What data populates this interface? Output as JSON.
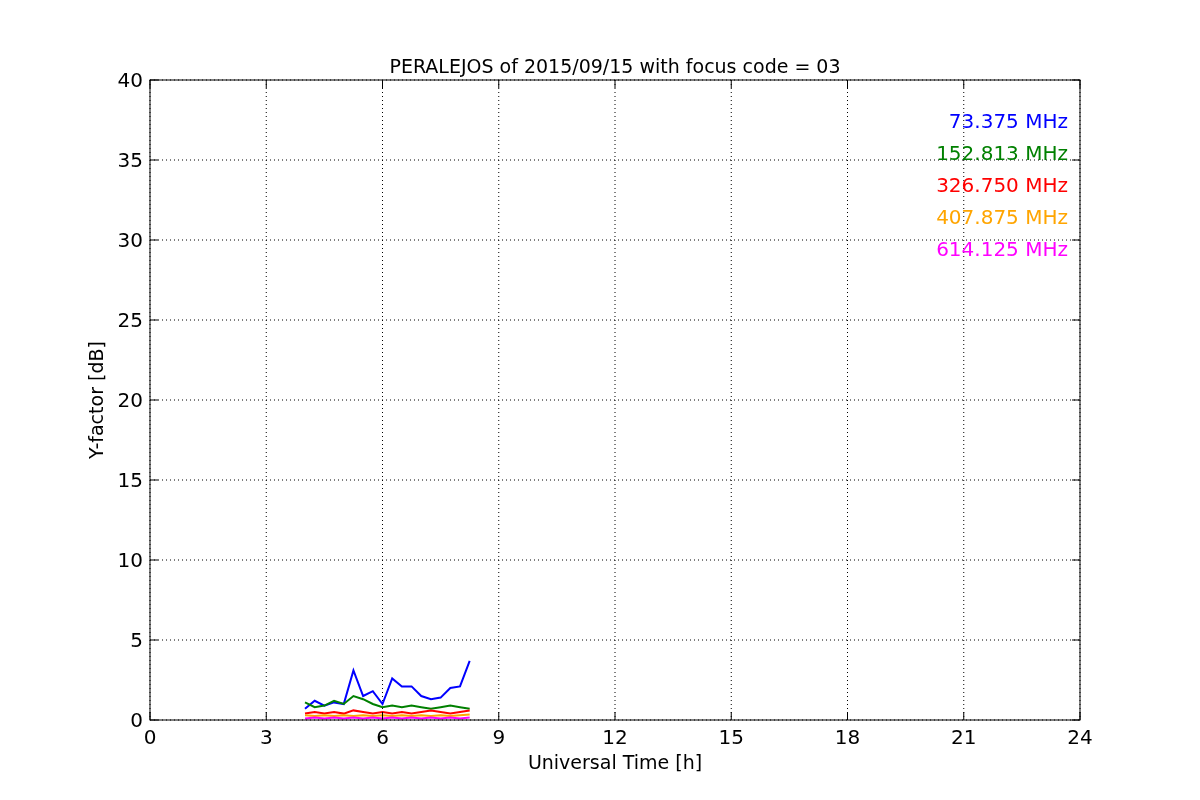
{
  "chart_data": {
    "type": "line",
    "title": "PERALEJOS of 2015/09/15 with focus code = 03",
    "xlabel": "Universal Time [h]",
    "ylabel": "Y-factor [dB]",
    "x": [
      4,
      4.25,
      4.5,
      4.75,
      5,
      5.25,
      5.5,
      5.75,
      6,
      6.25,
      6.5,
      6.75,
      7,
      7.25,
      7.5,
      7.75,
      8,
      8.25
    ],
    "grid": true,
    "xlim": [
      0,
      24
    ],
    "ylim": [
      0,
      40
    ],
    "xticks": [
      0,
      3,
      6,
      9,
      12,
      15,
      18,
      21,
      24
    ],
    "yticks": [
      0,
      5,
      10,
      15,
      20,
      25,
      30,
      35,
      40
    ],
    "series": [
      {
        "name": "73.375 MHz",
        "color": "#0000ff",
        "values": [
          0.7,
          1.2,
          0.9,
          1.1,
          1.0,
          3.1,
          1.5,
          1.8,
          1.0,
          2.6,
          2.1,
          2.1,
          1.5,
          1.3,
          1.4,
          2.0,
          2.1,
          3.7
        ]
      },
      {
        "name": "152.813 MHz",
        "color": "#008000",
        "values": [
          1.1,
          0.8,
          0.9,
          1.2,
          1.0,
          1.5,
          1.3,
          1.0,
          0.8,
          0.9,
          0.8,
          0.9,
          0.8,
          0.7,
          0.8,
          0.9,
          0.8,
          0.7
        ]
      },
      {
        "name": "326.750 MHz",
        "color": "#ff0000",
        "values": [
          0.4,
          0.5,
          0.4,
          0.5,
          0.4,
          0.6,
          0.5,
          0.4,
          0.5,
          0.4,
          0.5,
          0.4,
          0.5,
          0.6,
          0.5,
          0.4,
          0.5,
          0.6
        ]
      },
      {
        "name": "407.875 MHz",
        "color": "#ffa500",
        "values": [
          0.3,
          0.25,
          0.3,
          0.25,
          0.3,
          0.25,
          0.3,
          0.25,
          0.3,
          0.25,
          0.3,
          0.25,
          0.3,
          0.25,
          0.3,
          0.25,
          0.3,
          0.35
        ]
      },
      {
        "name": "614.125 MHz",
        "color": "#ff00ff",
        "values": [
          0.1,
          0.15,
          0.1,
          0.15,
          0.1,
          0.15,
          0.1,
          0.15,
          0.1,
          0.15,
          0.1,
          0.15,
          0.1,
          0.15,
          0.1,
          0.15,
          0.1,
          0.15
        ]
      }
    ]
  }
}
